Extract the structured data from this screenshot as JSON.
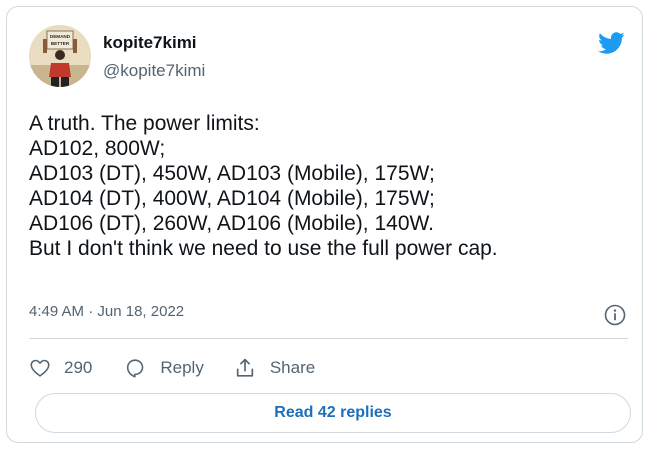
{
  "tweet": {
    "author_name": "kopite7kimi",
    "author_handle": "@kopite7kimi",
    "avatar_sign_text": "DEMAND BETTER",
    "lines": [
      "A truth. The power limits:",
      "AD102, 800W;",
      "AD103 (DT), 450W, AD103 (Mobile), 175W;",
      "AD104 (DT), 400W, AD104 (Mobile), 175W;",
      "AD106 (DT), 260W, AD106 (Mobile), 140W.",
      "But I don't think we need to use the full power cap."
    ],
    "time": "4:49 AM",
    "separator": "·",
    "date": "Jun 18, 2022"
  },
  "actions": {
    "like_count": "290",
    "reply_label": "Reply",
    "share_label": "Share"
  },
  "read_replies_label": "Read 42 replies",
  "colors": {
    "twitter_blue": "#1d9bf0",
    "link_blue": "#1d6fb8",
    "muted": "#536471",
    "border": "#cfd9de"
  },
  "icons": [
    "twitter-bird-icon",
    "info-icon",
    "heart-icon",
    "reply-bubble-icon",
    "share-icon"
  ]
}
